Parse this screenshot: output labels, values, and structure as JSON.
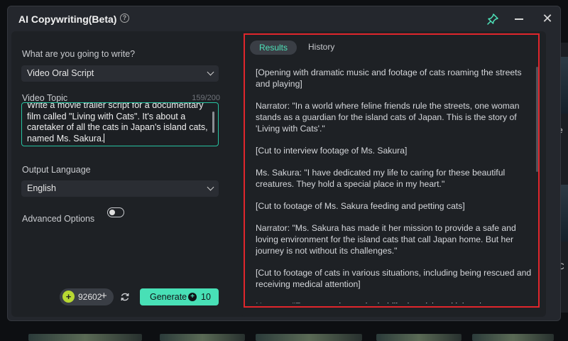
{
  "window": {
    "title": "AI Copywriting(Beta)",
    "accent": "#48e0b6",
    "highlight_color": "#e0262c"
  },
  "form": {
    "write_label": "What are you going to write?",
    "write_value": "Video Oral Script",
    "topic_label": "Video Topic",
    "topic_count": "159/200",
    "topic_text": "Write a movie trailer script for a documentary film called \"Living with Cats\". It's about a caretaker of all the cats in Japan's island cats, named Ms. Sakura.",
    "language_label": "Output Language",
    "language_value": "English",
    "advanced_label": "Advanced Options",
    "advanced_enabled": false
  },
  "footer": {
    "credits": "92602",
    "generate_label": "Generate",
    "generate_cost": "10"
  },
  "tabs": {
    "results": "Results",
    "history": "History",
    "active": "Results"
  },
  "results": {
    "paragraphs": [
      "[Opening with dramatic music and footage of cats roaming the streets and playing]",
      "Narrator: \"In a world where feline friends rule the streets, one woman stands as a guardian for the island cats of Japan. This is the story of 'Living with Cats'.\"",
      "[Cut to interview footage of Ms. Sakura]",
      "Ms. Sakura: \"I have dedicated my life to caring for these beautiful creatures. They hold a special place in my heart.\"",
      "[Cut to footage of Ms. Sakura feeding and petting cats]",
      "Narrator: \"Ms. Sakura has made it her mission to provide a safe and loving environment for the island cats that call Japan home. But her journey is not without its challenges.\"",
      "[Cut to footage of cats in various situations, including being rescued and receiving medical attention]",
      "Narrator: \"From rescuing and rehabilitating sick and injured cats, to"
    ]
  }
}
